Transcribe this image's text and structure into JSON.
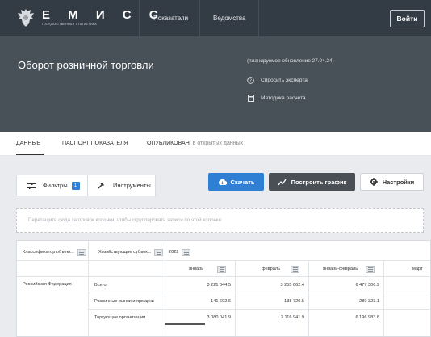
{
  "topbar": {
    "logo_title": "Е М И С С",
    "logo_subtitle": "ГОСУДАРСТВЕННАЯ СТАТИСТИКА",
    "nav": [
      "Показатели",
      "Ведомства"
    ],
    "login_label": "Войти"
  },
  "header": {
    "title": "Оборот розничной торговли",
    "update_note": "(планируемое обновление 27.04.24)",
    "ask_expert": "Спросить эксперта",
    "methodology": "Методика расчета"
  },
  "tabs": {
    "data": "ДАННЫЕ",
    "passport": "ПАСПОРТ ПОКАЗАТЕЛЯ",
    "published_label": "ОПУБЛИКОВАН:",
    "published_value": "в открытых данных"
  },
  "toolbar": {
    "filters_label": "Фильтры",
    "filters_count": "1",
    "tools_label": "Инструменты",
    "download_label": "Скачать",
    "chart_label": "Построить график",
    "settings_label": "Настройки"
  },
  "group_panel": {
    "hint": "Перетащите сюда заголовок колонки, чтобы сгруппировать записи по этой колонке"
  },
  "grid": {
    "col_headers": [
      "Классификатор объект...",
      "Хозяйствующие субъек...",
      "2022"
    ],
    "sub_headers": [
      "январь",
      "февраль",
      "январь-февраль",
      "март"
    ],
    "region": "Российская Федерация",
    "rows": [
      {
        "subject": "Всего",
        "jan": "3 221 644.5",
        "feb": "3 255 662.4",
        "janfeb": "6 477 306.9"
      },
      {
        "subject": "Розничные рынки и ярмарки",
        "jan": "141 602.6",
        "feb": "138 720.5",
        "janfeb": "280 323.1"
      },
      {
        "subject": "Торгующие организации",
        "jan": "3 080 041.9",
        "feb": "3 116 941.9",
        "janfeb": "6 196 983.8"
      }
    ]
  },
  "colors": {
    "topbar": "#333b45",
    "header": "#485058",
    "primary": "#2f7fd4",
    "dark_button": "#4a4f56",
    "content_bg": "#e9ebee"
  }
}
